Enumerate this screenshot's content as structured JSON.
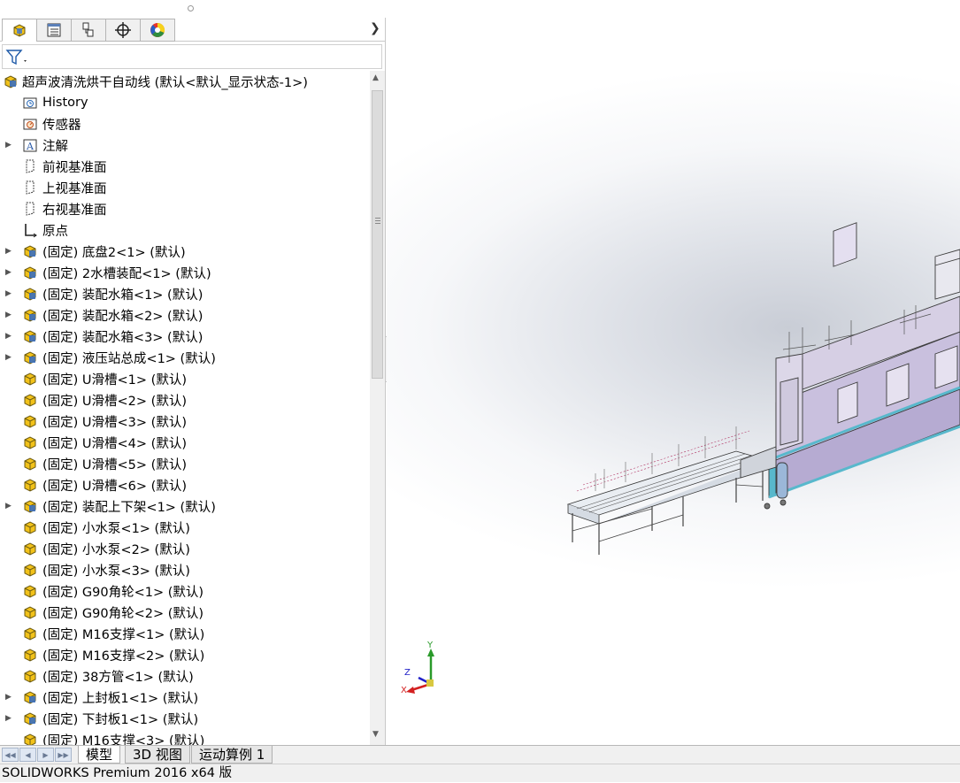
{
  "feature_manager": {
    "tabs": [
      {
        "name": "FeatureManager design tree",
        "icon": "part-tree-icon",
        "active": true
      },
      {
        "name": "PropertyManager",
        "icon": "property-manager-icon",
        "active": false
      },
      {
        "name": "ConfigurationManager",
        "icon": "configuration-manager-icon",
        "active": false
      },
      {
        "name": "DimXpertManager",
        "icon": "dimxpert-icon",
        "active": false
      },
      {
        "name": "DisplayManager",
        "icon": "display-manager-icon",
        "active": false
      }
    ],
    "root": {
      "label": "超声波清洗烘干自动线  (默认<默认_显示状态-1>)"
    },
    "items": [
      {
        "label": "History",
        "icon": "history-folder-icon",
        "expand": false
      },
      {
        "label": "传感器",
        "icon": "sensor-folder-icon",
        "expand": false
      },
      {
        "label": "注解",
        "icon": "annotation-icon",
        "expand": true
      },
      {
        "label": "前视基准面",
        "icon": "plane-icon",
        "expand": false
      },
      {
        "label": "上视基准面",
        "icon": "plane-icon",
        "expand": false
      },
      {
        "label": "右视基准面",
        "icon": "plane-icon",
        "expand": false
      },
      {
        "label": "原点",
        "icon": "origin-icon",
        "expand": false
      },
      {
        "label": "(固定) 底盘2<1> (默认)",
        "icon": "subassembly-icon",
        "expand": true
      },
      {
        "label": "(固定) 2水槽装配<1> (默认)",
        "icon": "subassembly-icon",
        "expand": true
      },
      {
        "label": "(固定) 装配水箱<1> (默认)",
        "icon": "subassembly-icon",
        "expand": true
      },
      {
        "label": "(固定) 装配水箱<2> (默认)",
        "icon": "subassembly-icon",
        "expand": true
      },
      {
        "label": "(固定) 装配水箱<3> (默认)",
        "icon": "subassembly-icon",
        "expand": true
      },
      {
        "label": "(固定) 液压站总成<1> (默认)",
        "icon": "subassembly-icon",
        "expand": true
      },
      {
        "label": "(固定) U滑槽<1> (默认)",
        "icon": "part-icon",
        "expand": false
      },
      {
        "label": "(固定) U滑槽<2> (默认)",
        "icon": "part-icon",
        "expand": false
      },
      {
        "label": "(固定) U滑槽<3> (默认)",
        "icon": "part-icon",
        "expand": false
      },
      {
        "label": "(固定) U滑槽<4> (默认)",
        "icon": "part-icon",
        "expand": false
      },
      {
        "label": "(固定) U滑槽<5> (默认)",
        "icon": "part-icon",
        "expand": false
      },
      {
        "label": "(固定) U滑槽<6> (默认)",
        "icon": "part-icon",
        "expand": false
      },
      {
        "label": "(固定) 装配上下架<1> (默认)",
        "icon": "subassembly-icon",
        "expand": true
      },
      {
        "label": "(固定) 小水泵<1> (默认)",
        "icon": "part-icon",
        "expand": false
      },
      {
        "label": "(固定) 小水泵<2> (默认)",
        "icon": "part-icon",
        "expand": false
      },
      {
        "label": "(固定) 小水泵<3> (默认)",
        "icon": "part-icon",
        "expand": false
      },
      {
        "label": "(固定) G90角轮<1> (默认)",
        "icon": "part-icon",
        "expand": false
      },
      {
        "label": "(固定) G90角轮<2> (默认)",
        "icon": "part-icon",
        "expand": false
      },
      {
        "label": "(固定) M16支撑<1> (默认)",
        "icon": "part-icon",
        "expand": false
      },
      {
        "label": "(固定) M16支撑<2> (默认)",
        "icon": "part-icon",
        "expand": false
      },
      {
        "label": "(固定) 38方管<1> (默认)",
        "icon": "part-icon",
        "expand": false
      },
      {
        "label": "(固定) 上封板1<1> (默认)",
        "icon": "subassembly-icon",
        "expand": true
      },
      {
        "label": "(固定) 下封板1<1> (默认)",
        "icon": "subassembly-icon",
        "expand": true
      },
      {
        "label": "(固定) M16支撑<3> (默认)",
        "icon": "part-icon",
        "expand": false
      }
    ]
  },
  "triad": {
    "x": "X",
    "y": "Y",
    "z": "Z"
  },
  "bottom_tabs": [
    {
      "label": "模型",
      "active": true
    },
    {
      "label": "3D 视图",
      "active": false
    },
    {
      "label": "运动算例 1",
      "active": false
    }
  ],
  "status_bar": {
    "text": "SOLIDWORKS Premium 2016 x64 版"
  },
  "colors": {
    "machine_body": "#c9c0de",
    "machine_frame": "#58b8cc",
    "tank_edge": "#3a3a3a"
  }
}
